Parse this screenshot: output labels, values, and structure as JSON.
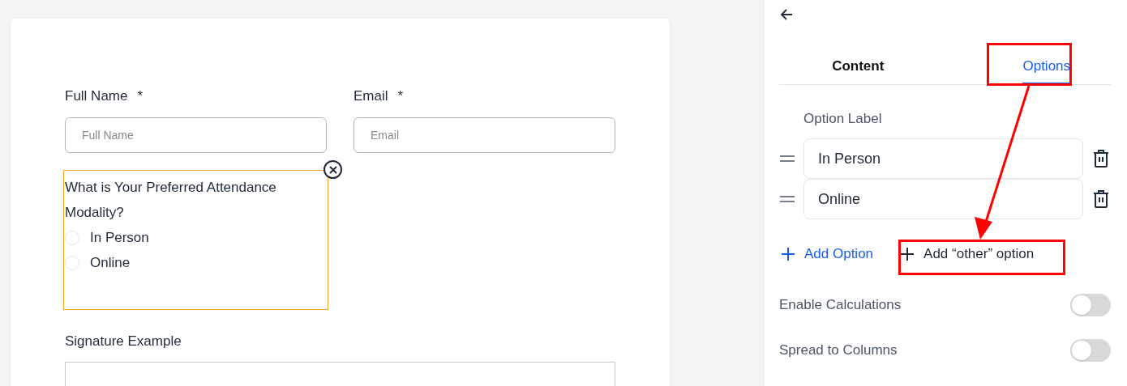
{
  "form": {
    "fields": [
      {
        "kind": "text",
        "label": "Full Name",
        "required": true,
        "placeholder": "Full Name"
      },
      {
        "kind": "text",
        "label": "Email",
        "required": true,
        "placeholder": "Email"
      },
      {
        "kind": "radio",
        "label": "What is Your Preferred Attendance Modality?",
        "active": true,
        "options": [
          {
            "label": "In Person",
            "selected": false
          },
          {
            "label": "Online",
            "selected": false
          }
        ]
      },
      {
        "kind": "signature",
        "label": "Signature Example"
      }
    ],
    "required_mark": "*"
  },
  "panel": {
    "tabs": [
      {
        "label": "Content",
        "selected": false
      },
      {
        "label": "Options",
        "selected": true
      }
    ],
    "option_label": "Option Label",
    "options": [
      {
        "value": "In Person"
      },
      {
        "value": "Online"
      }
    ],
    "add_option": "Add Option",
    "add_other": "Add “other” option",
    "toggles": [
      {
        "label": "Enable Calculations",
        "on": false
      },
      {
        "label": "Spread to Columns",
        "on": false
      }
    ]
  }
}
